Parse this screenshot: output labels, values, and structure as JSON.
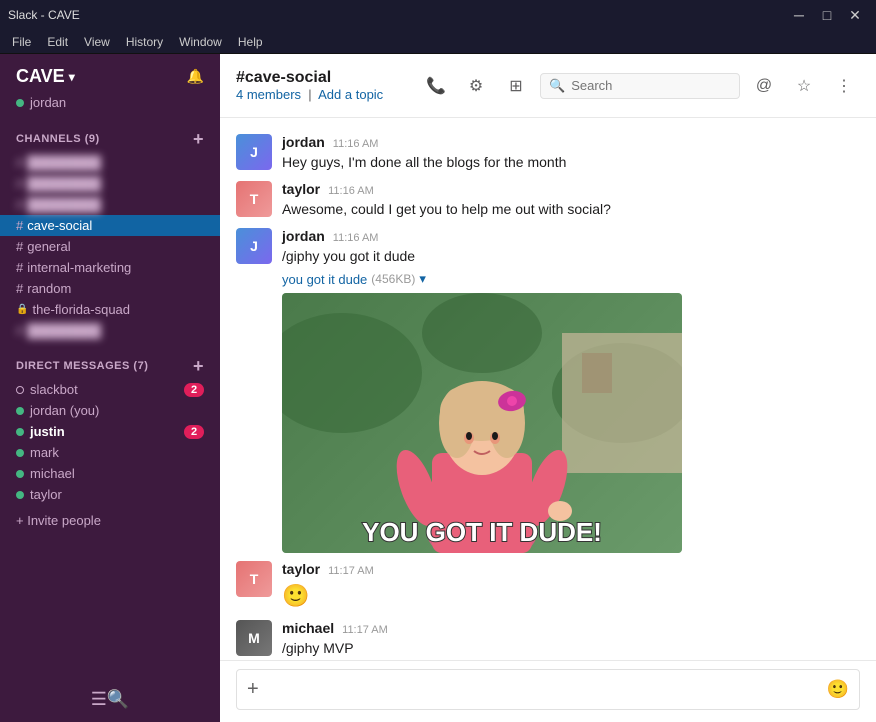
{
  "titlebar": {
    "title": "Slack - CAVE",
    "min": "─",
    "max": "□",
    "close": "✕"
  },
  "menubar": {
    "items": [
      "File",
      "Edit",
      "View",
      "History",
      "Window",
      "Help"
    ]
  },
  "sidebar": {
    "workspace": "CAVE",
    "user": "jordan",
    "channels_label": "CHANNELS",
    "channels_count": "(9)",
    "channels": [
      {
        "name": "blurred1",
        "blurred": true
      },
      {
        "name": "blurred2",
        "blurred": true
      },
      {
        "name": "blurred3",
        "blurred": true
      },
      {
        "name": "cave-social",
        "active": true
      },
      {
        "name": "general"
      },
      {
        "name": "internal-marketing"
      },
      {
        "name": "random"
      },
      {
        "name": "the-florida-squad",
        "locked": true
      },
      {
        "name": "blurred4",
        "blurred": true
      }
    ],
    "dm_label": "DIRECT MESSAGES",
    "dm_count": "(7)",
    "dms": [
      {
        "name": "slackbot",
        "badge": 2,
        "online": false
      },
      {
        "name": "jordan (you)",
        "badge": 0,
        "online": true
      },
      {
        "name": "justin",
        "badge": 2,
        "online": true,
        "bold": true
      },
      {
        "name": "mark",
        "badge": 0,
        "online": true
      },
      {
        "name": "michael",
        "badge": 0,
        "online": true
      },
      {
        "name": "taylor",
        "badge": 0,
        "online": true
      }
    ],
    "invite": "+ Invite people"
  },
  "channel": {
    "name": "#cave-social",
    "members": "4 members",
    "add_topic": "Add a topic",
    "search_placeholder": "Search"
  },
  "messages": [
    {
      "author": "jordan",
      "time": "11:16 AM",
      "text": "Hey guys, I'm done all the blogs for the month",
      "avatar_letter": "J",
      "has_giphy": false
    },
    {
      "author": "taylor",
      "time": "11:16 AM",
      "text": "Awesome, could I get you to help me out with social?",
      "avatar_letter": "T",
      "has_giphy": false
    },
    {
      "author": "jordan",
      "time": "11:16 AM",
      "text": "/giphy you got it dude",
      "avatar_letter": "J",
      "has_giphy": true,
      "giphy_label": "you got it dude",
      "giphy_size": "456KB",
      "giphy_text": "YOU GOT IT DUDE!"
    },
    {
      "author": "taylor",
      "time": "11:17 AM",
      "text": "🙂",
      "avatar_letter": "T",
      "has_giphy": false
    },
    {
      "author": "michael",
      "time": "11:17 AM",
      "text": "/giphy MVP",
      "avatar_letter": "M",
      "has_giphy": false
    }
  ],
  "input": {
    "placeholder": "",
    "emoji": "🙂"
  }
}
